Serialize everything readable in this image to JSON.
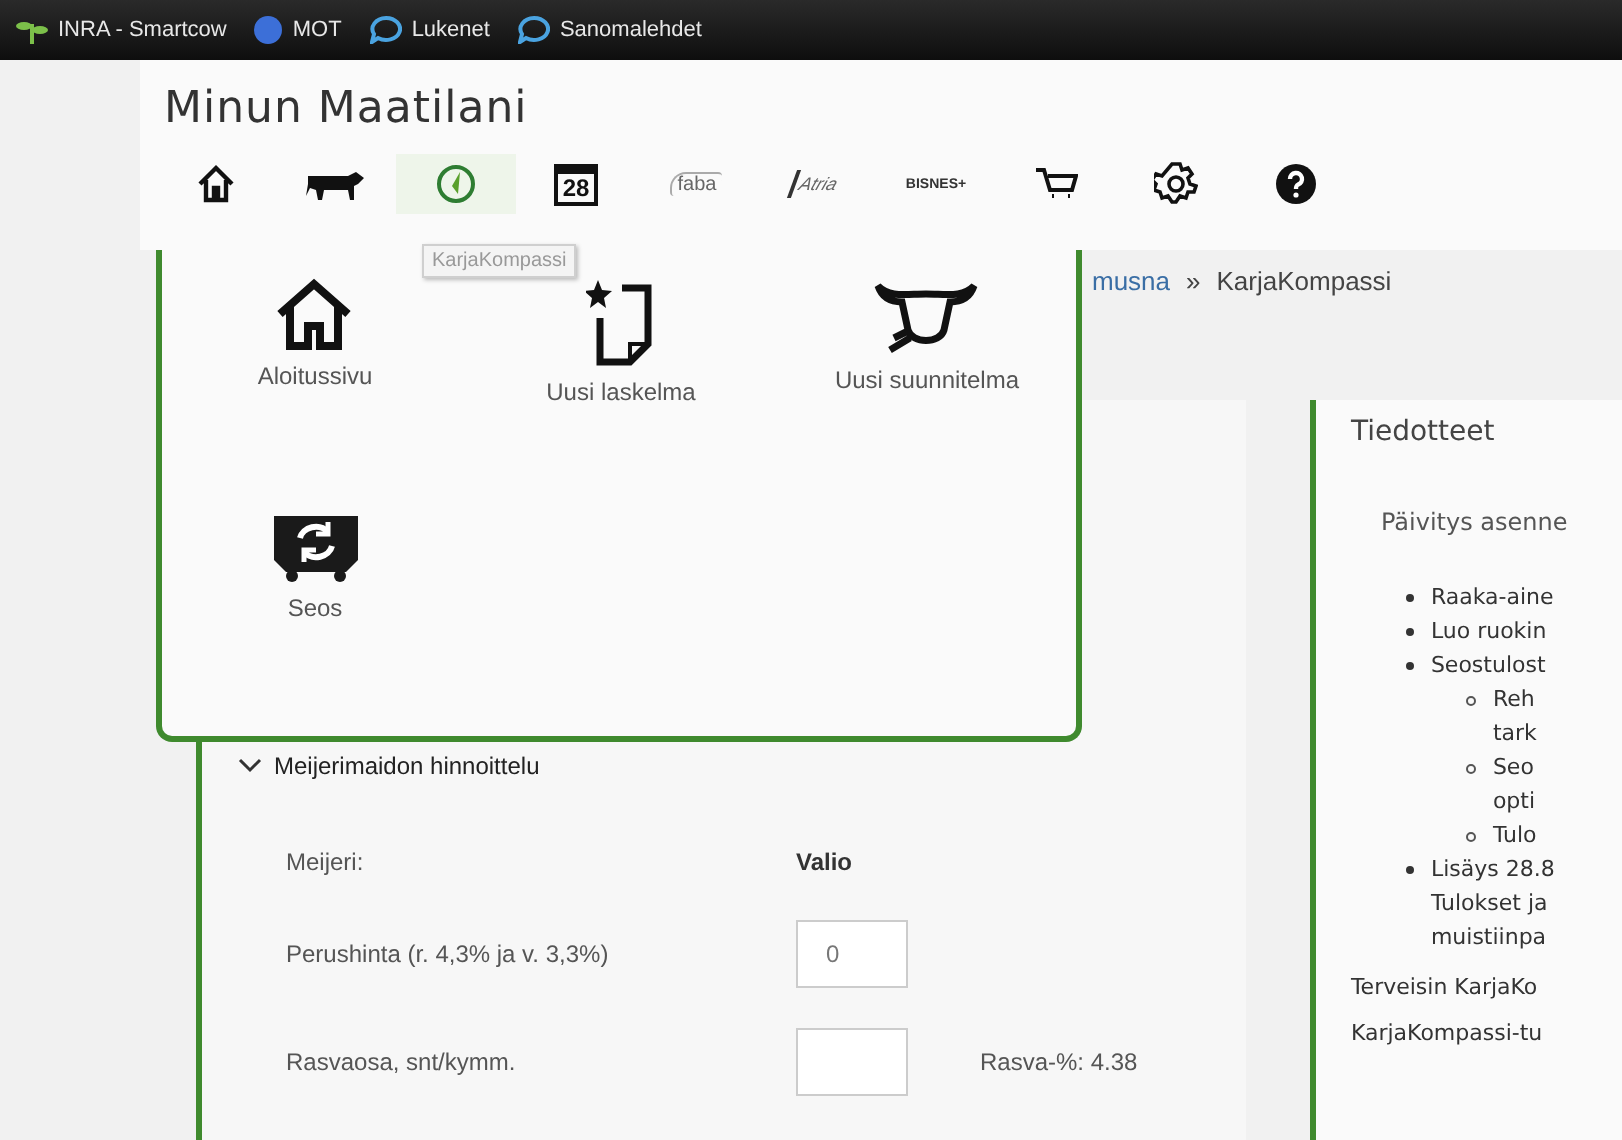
{
  "bookmarks": [
    {
      "label": "INRA - Smartcow",
      "kind": "plant"
    },
    {
      "label": "MOT",
      "kind": "circle"
    },
    {
      "label": "Lukenet",
      "kind": "bubble"
    },
    {
      "label": "Sanomalehdet",
      "kind": "bubble"
    }
  ],
  "header": {
    "title": "Minun Maatilani",
    "nav": [
      {
        "kind": "home",
        "selected": false
      },
      {
        "kind": "cow",
        "selected": false
      },
      {
        "kind": "compass",
        "selected": true
      },
      {
        "kind": "calendar",
        "text": "28",
        "selected": false
      },
      {
        "kind": "logo",
        "text": "faba",
        "selected": false
      },
      {
        "kind": "logo-script",
        "text": "Atria",
        "selected": false
      },
      {
        "kind": "wordmark",
        "text": "BISNES+",
        "selected": false
      },
      {
        "kind": "cart",
        "selected": false
      },
      {
        "kind": "gear",
        "selected": false
      },
      {
        "kind": "help",
        "selected": false
      }
    ],
    "tooltip": "KarjaKompassi"
  },
  "menu": {
    "items": [
      {
        "kind": "home",
        "label": "Aloitussivu"
      },
      {
        "kind": "new-doc",
        "label": "Uusi laskelma"
      },
      {
        "kind": "cow-head",
        "label": "Uusi suunnitelma"
      },
      {
        "kind": "mix",
        "label": "Seos"
      }
    ]
  },
  "breadcrumb": [
    {
      "label": "musna",
      "link": true
    },
    {
      "label": "»",
      "link": false
    },
    {
      "label": "KarjaKompassi",
      "link": false
    }
  ],
  "pricing": {
    "title": "Meijerimaidon hinnoittelu",
    "expanded": true,
    "rows": [
      {
        "label": "Meijeri:",
        "kind": "text",
        "value": "Valio"
      },
      {
        "label": "Perushinta (r. 4,3% ja v. 3,3%)",
        "kind": "input",
        "value": "0"
      },
      {
        "label": "Rasvaosa, snt/kymm.",
        "kind": "input",
        "value": "",
        "note": "Rasva-%: 4.38"
      }
    ]
  },
  "news": {
    "title": "Tiedotteet",
    "intro": "Päivitys asenne",
    "items": [
      {
        "lines": [
          "Raaka-aine"
        ]
      },
      {
        "lines": [
          "Luo ruokin"
        ]
      },
      {
        "lines": [
          "Seostulost"
        ],
        "children": [
          {
            "lines": [
              "Reh",
              "tark"
            ]
          },
          {
            "lines": [
              "Seo",
              "opti"
            ]
          },
          {
            "lines": [
              "Tulo"
            ]
          }
        ]
      },
      {
        "lines": [
          "Lisäys 28.8",
          "Tulokset ja",
          "muistiinpa"
        ]
      }
    ],
    "footer": [
      "Terveisin KarjaKo",
      "KarjaKompassi-tu"
    ]
  }
}
